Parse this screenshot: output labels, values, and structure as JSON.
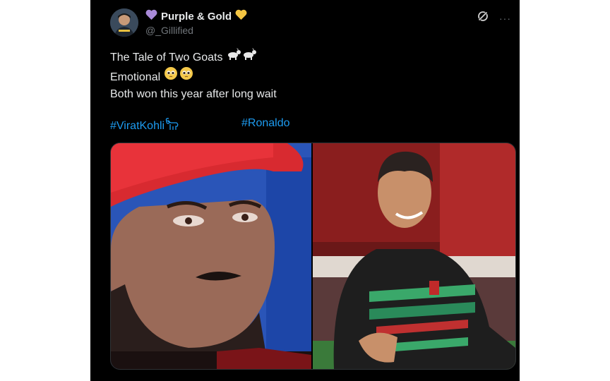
{
  "post": {
    "author_name": "Purple & Gold",
    "name_prefix_emoji": "purple-heart",
    "name_suffix_emoji": "yellow-heart",
    "handle": "@_Gillified",
    "lines": [
      "The Tale of Two Goats",
      "Emotional",
      "Both won this year after long wait"
    ],
    "line1_emoji": "goat goat",
    "line2_emoji": "pleading-face pleading-face",
    "hashtags": [
      "#ViratKohli",
      "#Ronaldo"
    ],
    "hashtag1_emoji": "goat"
  },
  "icons": {
    "top_right": [
      "grok-icon",
      "more-icon"
    ],
    "more": "···"
  },
  "media": {
    "images": [
      "left-photo",
      "right-photo"
    ]
  }
}
